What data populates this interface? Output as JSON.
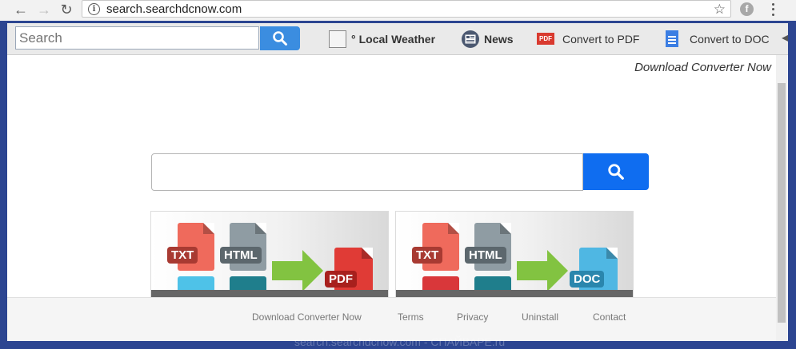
{
  "browser": {
    "url": "search.searchdcnow.com",
    "back_glyph": "←",
    "forward_glyph": "→",
    "reload_glyph": "↻",
    "star_glyph": "☆",
    "info_glyph": "i"
  },
  "toolbar": {
    "search_placeholder": "Search",
    "weather_degree": "°",
    "weather_label": "Local Weather",
    "news_label": "News",
    "pdf_icon_text": "PDF",
    "convert_pdf_label": "Convert to PDF",
    "convert_doc_label": "Convert to DOC"
  },
  "header": {
    "download_link": "Download Converter Now"
  },
  "main_search": {
    "value": ""
  },
  "cards": [
    {
      "tags": [
        "TXT",
        "HTML",
        "PDF"
      ],
      "target_color": "#e03b36"
    },
    {
      "tags": [
        "TXT",
        "HTML",
        "DOC"
      ],
      "target_color": "#4fb7e3"
    }
  ],
  "footer": {
    "links": [
      "Download Converter Now",
      "Terms",
      "Privacy",
      "Uninstall",
      "Contact"
    ]
  },
  "watermark": "search.searchdcnow.com - СПАЙВАРЕ.ru",
  "colors": {
    "toolbar_search_button": "#3b8de0",
    "main_search_button": "#0f6df0",
    "desktop_background": "#2c4591"
  }
}
